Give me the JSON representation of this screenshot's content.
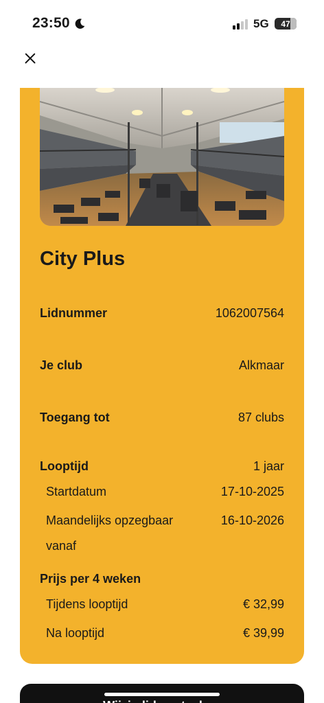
{
  "status_bar": {
    "time": "23:50",
    "network": "5G",
    "battery": "47"
  },
  "membership": {
    "name": "City Plus",
    "rows": [
      {
        "label": "Lidnummer",
        "value": "1062007564"
      },
      {
        "label": "Je club",
        "value": "Alkmaar"
      },
      {
        "label": "Toegang tot",
        "value": "87 clubs"
      }
    ],
    "term": {
      "label": "Looptijd",
      "value": "1 jaar",
      "start_label": "Startdatum",
      "start_value": "17-10-2025",
      "cancel_label": "Maandelijks opzegbaar vanaf",
      "cancel_value": "16-10-2026"
    },
    "price": {
      "label": "Prijs per 4 weken",
      "during_label": "Tijdens looptijd",
      "during_value": "€ 32,99",
      "after_label": "Na looptijd",
      "after_value": "€ 39,99"
    }
  },
  "bottom_button": {
    "label": "Wijzig lidmaatschap"
  },
  "colors": {
    "card": "#f3b22c",
    "button": "#111111"
  }
}
